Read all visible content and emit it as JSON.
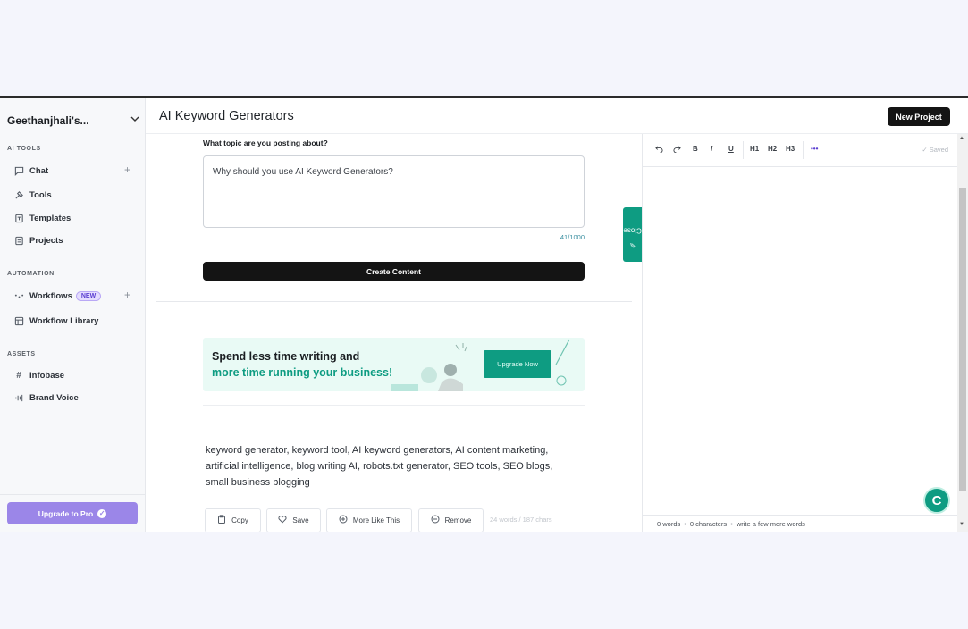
{
  "sidebar": {
    "workspace": "Geethanjhali's...",
    "sections": {
      "ai_tools": "AI TOOLS",
      "automation": "AUTOMATION",
      "assets": "ASSETS"
    },
    "items": [
      {
        "label": "Chat",
        "icon": "chat-icon"
      },
      {
        "label": "Tools",
        "icon": "tools-icon"
      },
      {
        "label": "Templates",
        "icon": "templates-icon"
      },
      {
        "label": "Projects",
        "icon": "projects-icon"
      },
      {
        "label": "Workflows",
        "icon": "workflows-icon",
        "badge": "NEW"
      },
      {
        "label": "Workflow Library",
        "icon": "library-icon"
      },
      {
        "label": "Infobase",
        "icon": "hash-icon"
      },
      {
        "label": "Brand Voice",
        "icon": "voice-icon"
      }
    ],
    "upgrade_label": "Upgrade to Pro"
  },
  "header": {
    "title": "AI Keyword Generators",
    "new_project_label": "New Project"
  },
  "form": {
    "question": "What topic are you posting about?",
    "topic_value": "Why should you use AI Keyword Generators?",
    "counter": "41/1000",
    "create_label": "Create Content"
  },
  "banner": {
    "line1": "Spend less time writing and",
    "line2": "more time running your business!",
    "button": "Upgrade Now"
  },
  "result": {
    "text": "keyword generator, keyword tool, AI keyword generators, AI content marketing, artificial intelligence, blog writing AI, robots.txt generator, SEO tools, SEO blogs, small business blogging",
    "actions": {
      "copy": "Copy",
      "save": "Save",
      "more": "More Like This",
      "remove": "Remove"
    },
    "meta": "24 words / 187 chars"
  },
  "close_tab": "Close",
  "editor": {
    "toolbar": {
      "bold": "B",
      "italic": "I",
      "underline": "U",
      "h1": "H1",
      "h2": "H2",
      "h3": "H3",
      "more": "•••",
      "saved": "✓ Saved"
    },
    "status": {
      "words": "0 words",
      "chars": "0 characters",
      "hint": "write a few more words"
    }
  },
  "fab_label": "C",
  "colors": {
    "accent": "#0e9c82",
    "upgrade": "#9b86e8",
    "dark_button": "#141414"
  }
}
